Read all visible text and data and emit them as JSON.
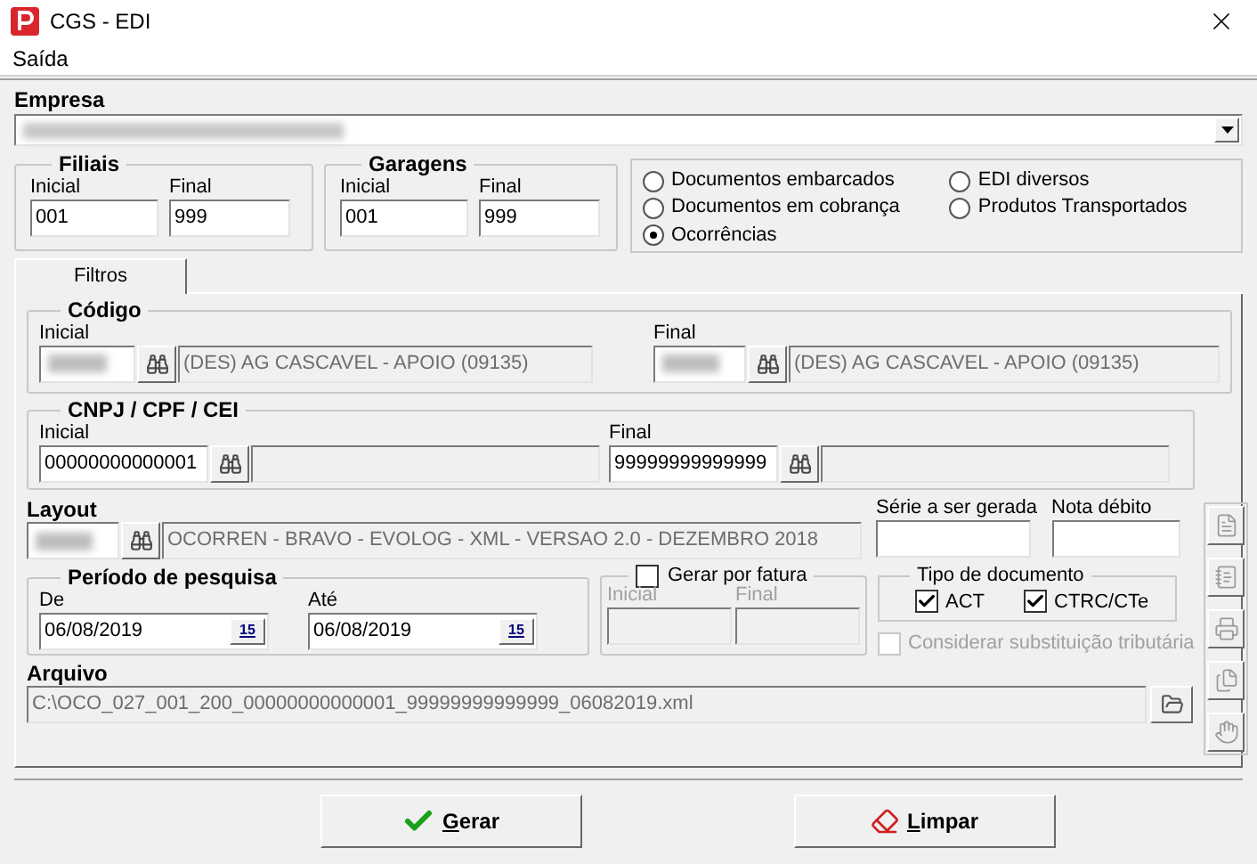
{
  "window": {
    "title": "CGS - EDI"
  },
  "menu": [
    "Saída"
  ],
  "empresa": {
    "label": "Empresa"
  },
  "filiais": {
    "title": "Filiais",
    "inicial_label": "Inicial",
    "inicial": "001",
    "final_label": "Final",
    "final": "999"
  },
  "garagens": {
    "title": "Garagens",
    "inicial_label": "Inicial",
    "inicial": "001",
    "final_label": "Final",
    "final": "999"
  },
  "report_types": [
    {
      "label": "Documentos embarcados",
      "selected": false
    },
    {
      "label": "Documentos em cobrança",
      "selected": false
    },
    {
      "label": "Ocorrências",
      "selected": true
    },
    {
      "label": "EDI diversos",
      "selected": false
    },
    {
      "label": "Produtos Transportados",
      "selected": false
    }
  ],
  "tabs": [
    {
      "label": "Filtros",
      "selected": true
    }
  ],
  "codigo": {
    "title": "Código",
    "inicial_label": "Inicial",
    "inicial_desc": "(DES) AG CASCAVEL - APOIO (09135)",
    "final_label": "Final",
    "final_desc": "(DES) AG CASCAVEL - APOIO (09135)"
  },
  "cnpj": {
    "title": "CNPJ / CPF / CEI",
    "inicial_label": "Inicial",
    "inicial": "00000000000001",
    "final_label": "Final",
    "final": "99999999999999"
  },
  "layout": {
    "label": "Layout",
    "description": "OCORREN - BRAVO - EVOLOG - XML - VERSAO 2.0 - DEZEMBRO 2018",
    "serie_label": "Série a ser gerada",
    "nota_label": "Nota débito"
  },
  "periodo": {
    "title": "Período de pesquisa",
    "de_label": "De",
    "de": "06/08/2019",
    "ate_label": "Até",
    "ate": "06/08/2019",
    "de_calendar": "15",
    "ate_calendar": "15"
  },
  "gerar_por_fatura": {
    "label": "Gerar por fatura",
    "checked": false,
    "inicial_label": "Inicial",
    "final_label": "Final"
  },
  "tipo_documento": {
    "title": "Tipo de documento",
    "items": [
      {
        "label": "ACT",
        "checked": true
      },
      {
        "label": "CTRC/CTe",
        "checked": true
      }
    ]
  },
  "considerar": {
    "label": "Considerar substituição tributária",
    "checked": false,
    "disabled": true
  },
  "arquivo": {
    "label": "Arquivo",
    "value": "C:\\OCO_027_001_200_00000000000001_99999999999999_06082019.xml"
  },
  "buttons": [
    {
      "label": "Gerar",
      "kind": "generate"
    },
    {
      "label": "Limpar",
      "kind": "clear"
    }
  ]
}
